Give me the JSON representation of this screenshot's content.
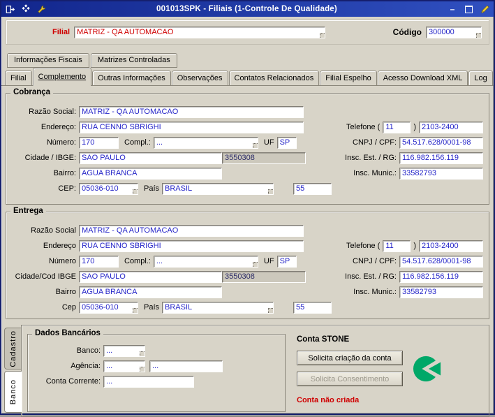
{
  "colors": {
    "title_bar_blue": "#12268c",
    "value_blue": "#2525c8",
    "alert_red": "#cf0000",
    "stone_green": "#00a868",
    "window_gray": "#d8d4c8"
  },
  "titlebar": {
    "title": "001013SPK - Filiais (1-Controle De Qualidade)",
    "minimize_glyph": "–"
  },
  "header": {
    "filial_label": "Filial",
    "filial_value": "MATRIZ - QA AUTOMACAO",
    "codigo_label": "Código",
    "codigo_value": "300000"
  },
  "tabs_top": {
    "items": [
      {
        "label": "Informações Fiscais"
      },
      {
        "label": "Matrizes Controladas"
      }
    ]
  },
  "tabs_main": {
    "active": "Complemento",
    "items": [
      {
        "label": "Filial"
      },
      {
        "label": "Complemento"
      },
      {
        "label": "Outras Informações"
      },
      {
        "label": "Observações"
      },
      {
        "label": "Contatos Relacionados"
      },
      {
        "label": "Filial Espelho"
      },
      {
        "label": "Acesso Download XML"
      },
      {
        "label": "Log"
      }
    ]
  },
  "cobranca": {
    "title": "Cobrança",
    "razao_label": "Razão Social:",
    "razao": "MATRIZ - QA AUTOMACAO",
    "endereco_label": "Endereço:",
    "endereco": "RUA CENNO SBRIGHI",
    "numero_label": "Número:",
    "numero": "170",
    "compl_label": "Compl.:",
    "compl": "...",
    "uf_label": "UF",
    "uf": "SP",
    "cidade_label": "Cidade / IBGE:",
    "cidade": "SAO PAULO",
    "ibge": "3550308",
    "bairro_label": "Bairro:",
    "bairro": "AGUA BRANCA",
    "cep_label": "CEP:",
    "cep": "05036-010",
    "pais_label": "País",
    "pais": "BRASIL",
    "ddi": "55",
    "telefone_label": "Telefone (",
    "ddd": "11",
    "telefone_close": ")",
    "telefone": "2103-2400",
    "cnpj_label": "CNPJ / CPF:",
    "cnpj": "54.517.628/0001-98",
    "inscest_label": "Insc. Est. / RG:",
    "inscest": "116.982.156.119",
    "inscmun_label": "Insc. Munic.:",
    "inscmun": "33582793"
  },
  "entrega": {
    "title": "Entrega",
    "razao_label": "Razão Social",
    "razao": "MATRIZ - QA AUTOMACAO",
    "endereco_label": "Endereço",
    "endereco": "RUA CENNO SBRIGHI",
    "numero_label": "Número",
    "numero": "170",
    "compl_label": "Compl.:",
    "compl": "...",
    "uf_label": "UF",
    "uf": "SP",
    "cidade_label": "Cidade/Cod IBGE",
    "cidade": "SAO PAULO",
    "ibge": "3550308",
    "bairro_label": "Bairro",
    "bairro": "AGUA BRANCA",
    "cep_label": "Cep",
    "cep": "05036-010",
    "pais_label": "País",
    "pais": "BRASIL",
    "ddi": "55",
    "telefone_label": "Telefone (",
    "ddd": "11",
    "telefone_close": ")",
    "telefone": "2103-2400",
    "cnpj_label": "CNPJ / CPF:",
    "cnpj": "54.517.628/0001-98",
    "inscest_label": "Insc. Est. / RG:",
    "inscest": "116.982.156.119",
    "inscmun_label": "Insc. Munic.:",
    "inscmun": "33582793"
  },
  "side_tabs": {
    "active": "Banco",
    "items": [
      {
        "label": "Cadastro"
      },
      {
        "label": "Banco"
      }
    ]
  },
  "dados_bancarios": {
    "title": "Dados Bancários",
    "banco_label": "Banco:",
    "banco": "...",
    "agencia_label": "Agência:",
    "agencia": "...",
    "agencia2": "...",
    "conta_label": "Conta Corrente:",
    "conta": "..."
  },
  "conta_stone": {
    "title": "Conta STONE",
    "botao_criacao": "Solicita criação da conta",
    "botao_consentimento": "Solicita Consentimento",
    "status": "Conta não criada"
  }
}
